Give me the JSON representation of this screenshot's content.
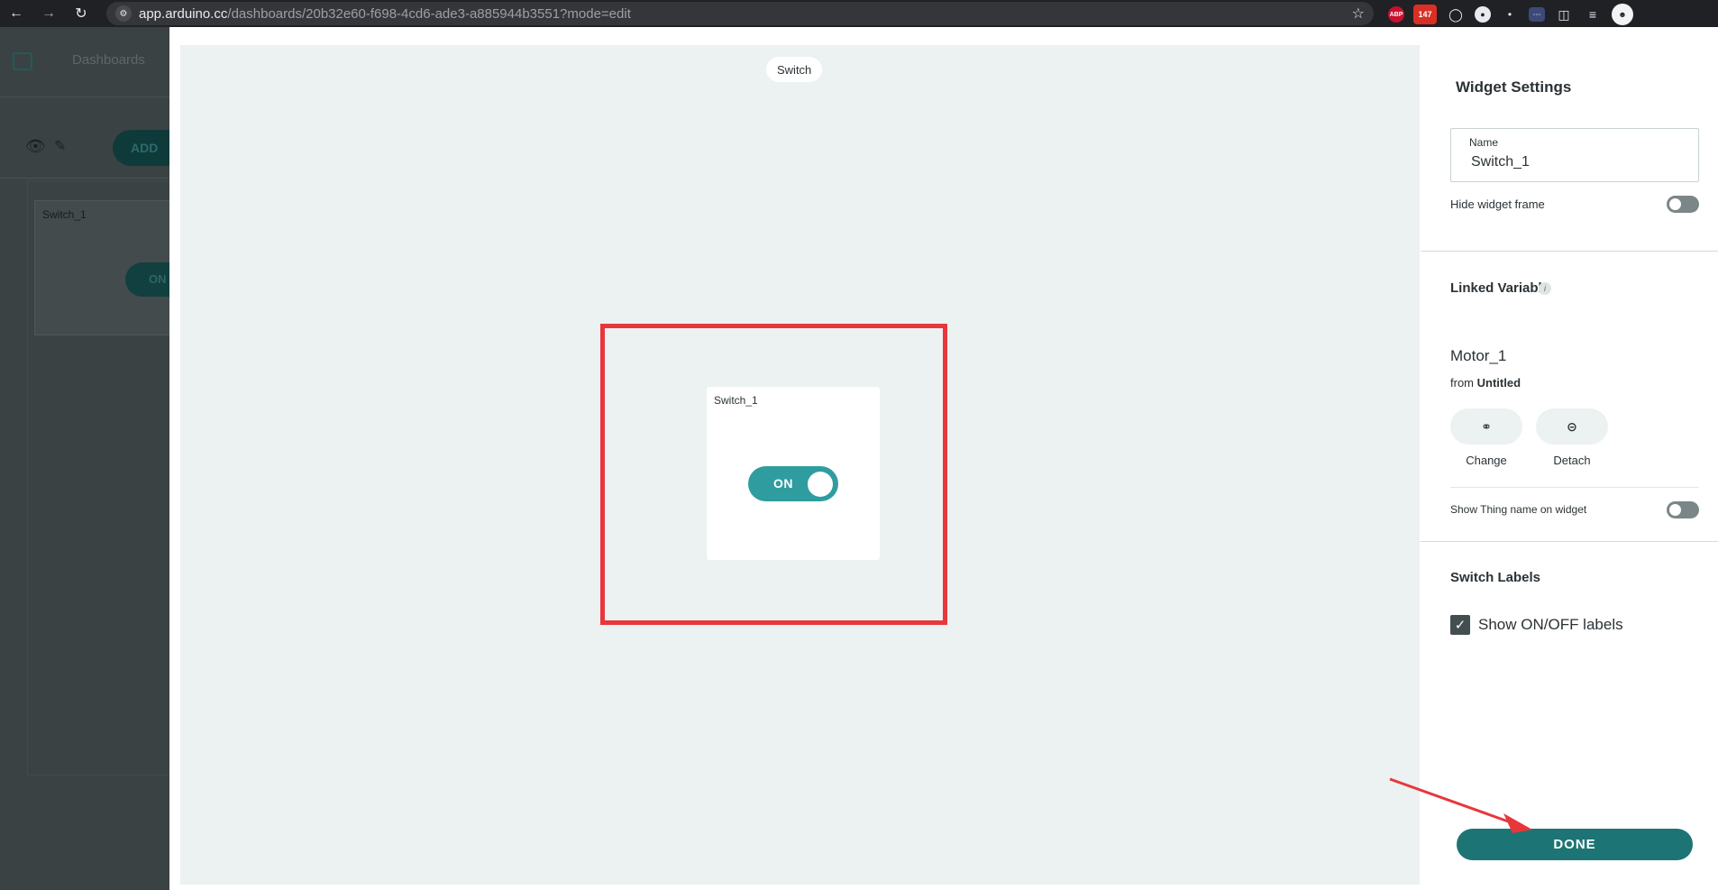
{
  "browser": {
    "url_host": "app.arduino.cc",
    "url_path": "/dashboards/20b32e60-f698-4cd6-ade3-a885944b3551?mode=edit",
    "badge_count": "147",
    "abp_label": "ABP"
  },
  "background": {
    "breadcrumb": "Dashboards",
    "add_label": "ADD",
    "card_title": "Switch_1",
    "card_toggle": "ON"
  },
  "canvas": {
    "type_pill": "Switch",
    "widget": {
      "title": "Switch_1",
      "toggle_label": "ON",
      "state": "on"
    }
  },
  "settings": {
    "title": "Widget Settings",
    "name_label": "Name",
    "name_value": "Switch_1",
    "hide_frame_label": "Hide widget frame",
    "hide_frame_on": false,
    "linked_variable_title": "Linked Variable",
    "variable_name": "Motor_1",
    "from_prefix": "from",
    "from_thing": "Untitled",
    "change_label": "Change",
    "detach_label": "Detach",
    "show_thing_label": "Show Thing name on widget",
    "show_thing_on": false,
    "switch_labels_title": "Switch Labels",
    "show_labels_text": "Show ON/OFF labels",
    "show_labels_checked": true,
    "done_label": "DONE"
  },
  "colors": {
    "accent": "#1d7474",
    "toggle_on": "#2f9d9f",
    "highlight": "#e8373b"
  }
}
